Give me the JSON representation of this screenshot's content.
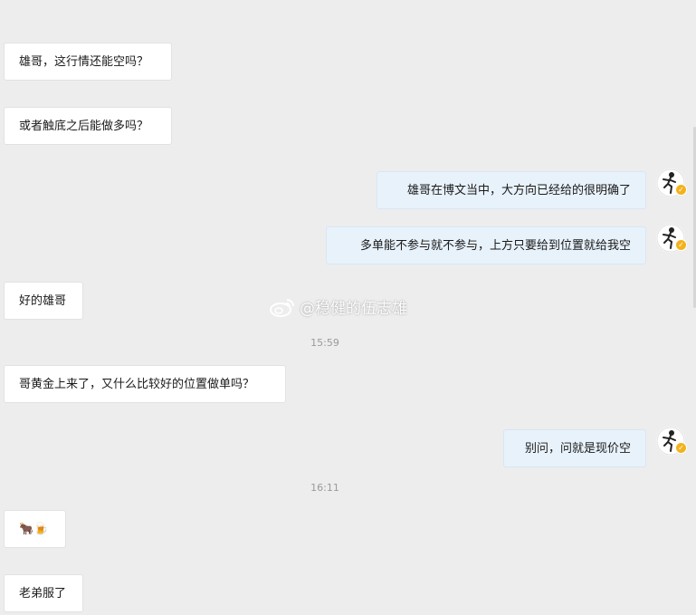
{
  "messages": [
    {
      "side": "left",
      "text": "雄哥，这行情还能空吗？"
    },
    {
      "side": "left",
      "text": "或者触底之后能做多吗？"
    },
    {
      "side": "right",
      "text": "雄哥在博文当中，大方向已经给的很明确了"
    },
    {
      "side": "right",
      "text": "多单能不参与就不参与，上方只要给到位置就给我空"
    },
    {
      "side": "left",
      "text": "好的雄哥"
    },
    {
      "side": "left",
      "text": "哥黄金上来了，又什么比较好的位置做单吗？"
    },
    {
      "side": "right",
      "text": "别问，问就是现价空"
    },
    {
      "side": "left",
      "text": "🐂🍺"
    },
    {
      "side": "left",
      "text": "老弟服了"
    }
  ],
  "timestamps": [
    "15:59",
    "16:11"
  ],
  "watermark": "@稳健的伍志雄",
  "icons": {
    "avatar": "avatar-icon",
    "verified": "verified-badge-icon",
    "weibo": "weibo-logo-icon"
  },
  "colors": {
    "background": "#ededed",
    "left_bubble": "#ffffff",
    "right_bubble": "#e8f2fb",
    "badge": "#f3b21b"
  }
}
